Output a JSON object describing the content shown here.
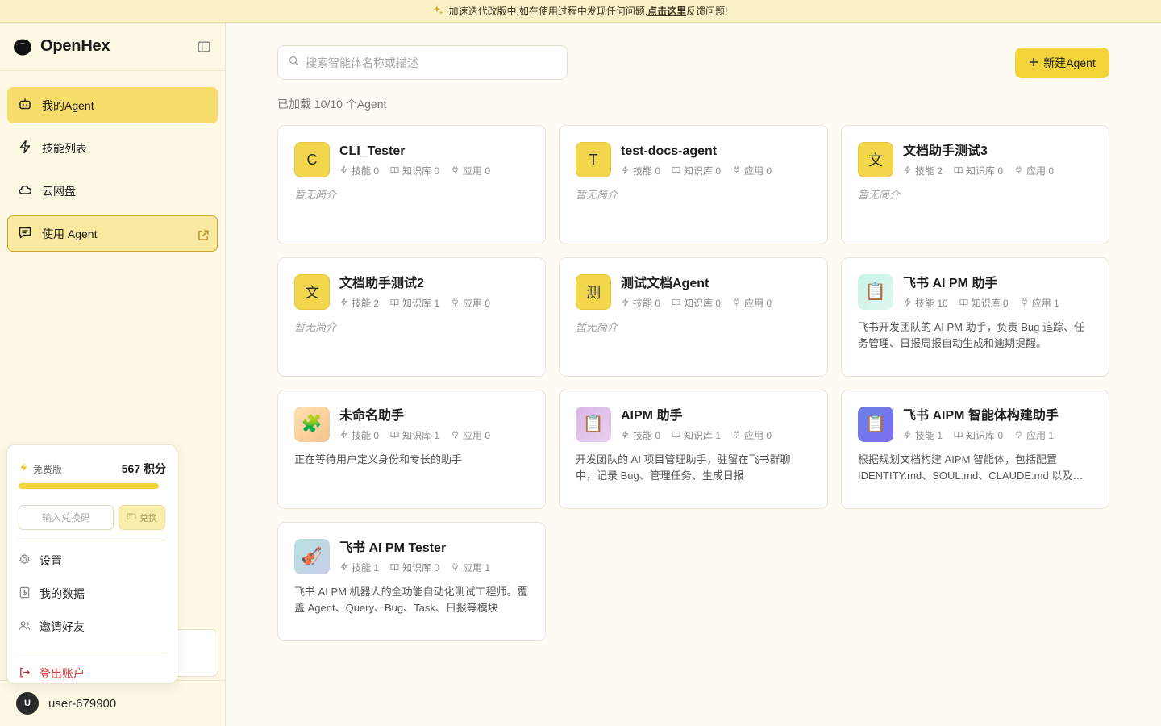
{
  "banner": {
    "text_before": "加速迭代改版中,如在使用过程中发现任何问题,",
    "link": "点击这里",
    "text_after": "反馈问题!"
  },
  "sidebar": {
    "brand": "OpenHex",
    "items": [
      {
        "label": "我的Agent",
        "icon": "robot-icon"
      },
      {
        "label": "技能列表",
        "icon": "lightning-icon"
      },
      {
        "label": "云网盘",
        "icon": "cloud-icon"
      },
      {
        "label": "使用 Agent",
        "icon": "message-icon"
      }
    ]
  },
  "account_popup": {
    "plan": "免费版",
    "points": "567 积分",
    "progress_fraction": 1.0,
    "redeem_placeholder": "输入兑换码",
    "redeem_button": "兑换",
    "menu": [
      {
        "label": "设置",
        "icon": "gear-icon"
      },
      {
        "label": "我的数据",
        "icon": "data-icon"
      },
      {
        "label": "邀请好友",
        "icon": "users-icon"
      }
    ],
    "logout": "登出账户"
  },
  "user": {
    "initial": "U",
    "name": "user-679900"
  },
  "main": {
    "search_placeholder": "搜索智能体名称或描述",
    "new_button": "新建Agent",
    "count_text": "已加载 10/10 个Agent",
    "cards": [
      {
        "icon": "C",
        "icon_style": "yellow",
        "title": "CLI_Tester",
        "skills": "技能 0",
        "kb": "知识库 0",
        "apps": "应用 0",
        "desc": "暂无简介",
        "empty": true
      },
      {
        "icon": "T",
        "icon_style": "yellow",
        "title": "test-docs-agent",
        "skills": "技能 0",
        "kb": "知识库 0",
        "apps": "应用 0",
        "desc": "暂无简介",
        "empty": true
      },
      {
        "icon": "文",
        "icon_style": "yellow",
        "title": "文档助手测试3",
        "skills": "技能 2",
        "kb": "知识库 0",
        "apps": "应用 0",
        "desc": "暂无简介",
        "empty": true
      },
      {
        "icon": "文",
        "icon_style": "yellow",
        "title": "文档助手测试2",
        "skills": "技能 2",
        "kb": "知识库 1",
        "apps": "应用 0",
        "desc": "暂无简介",
        "empty": true
      },
      {
        "icon": "测",
        "icon_style": "yellow",
        "title": "测试文档Agent",
        "skills": "技能 0",
        "kb": "知识库 0",
        "apps": "应用 0",
        "desc": "暂无简介",
        "empty": true
      },
      {
        "icon": "📋",
        "icon_style": "mint",
        "title": "飞书 AI PM 助手",
        "skills": "技能 10",
        "kb": "知识库 0",
        "apps": "应用 1",
        "desc": "飞书开发团队的 AI PM 助手，负责 Bug 追踪、任务管理、日报周报自动生成和逾期提醒。",
        "empty": false
      },
      {
        "icon": "🧩",
        "icon_style": "orange",
        "title": "未命名助手",
        "skills": "技能 0",
        "kb": "知识库 1",
        "apps": "应用 0",
        "desc": "正在等待用户定义身份和专长的助手",
        "empty": false
      },
      {
        "icon": "📋",
        "icon_style": "purple",
        "title": "AIPM 助手",
        "skills": "技能 0",
        "kb": "知识库 1",
        "apps": "应用 0",
        "desc": "开发团队的 AI 项目管理助手，驻留在飞书群聊中，记录 Bug、管理任务、生成日报",
        "empty": false
      },
      {
        "icon": "📋",
        "icon_style": "blue",
        "title": "飞书 AIPM 智能体构建助手",
        "skills": "技能 1",
        "kb": "知识库 0",
        "apps": "应用 1",
        "desc": "根据规划文档构建 AIPM 智能体，包括配置 IDENTITY.md、SOUL.md、CLAUDE.md 以及相关技能和知识库",
        "empty": false
      },
      {
        "icon": "🎻",
        "icon_style": "teal",
        "title": "飞书 AI PM Tester",
        "skills": "技能 1",
        "kb": "知识库 0",
        "apps": "应用 1",
        "desc": "飞书 AI PM 机器人的全功能自动化测试工程师。覆盖 Agent、Query、Bug、Task、日报等模块",
        "empty": false
      }
    ]
  }
}
